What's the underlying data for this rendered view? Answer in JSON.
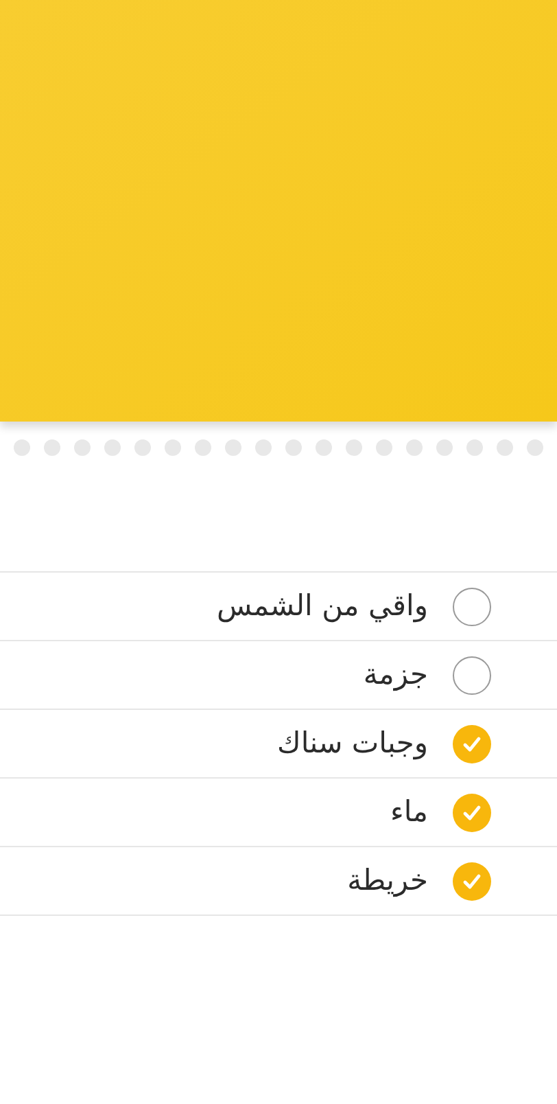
{
  "items": [
    {
      "label": "واقي من الشمس",
      "checked": false
    },
    {
      "label": "جزمة",
      "checked": false
    },
    {
      "label": "وجبات سناك",
      "checked": true
    },
    {
      "label": "ماء",
      "checked": true
    },
    {
      "label": "خريطة",
      "checked": true
    }
  ]
}
